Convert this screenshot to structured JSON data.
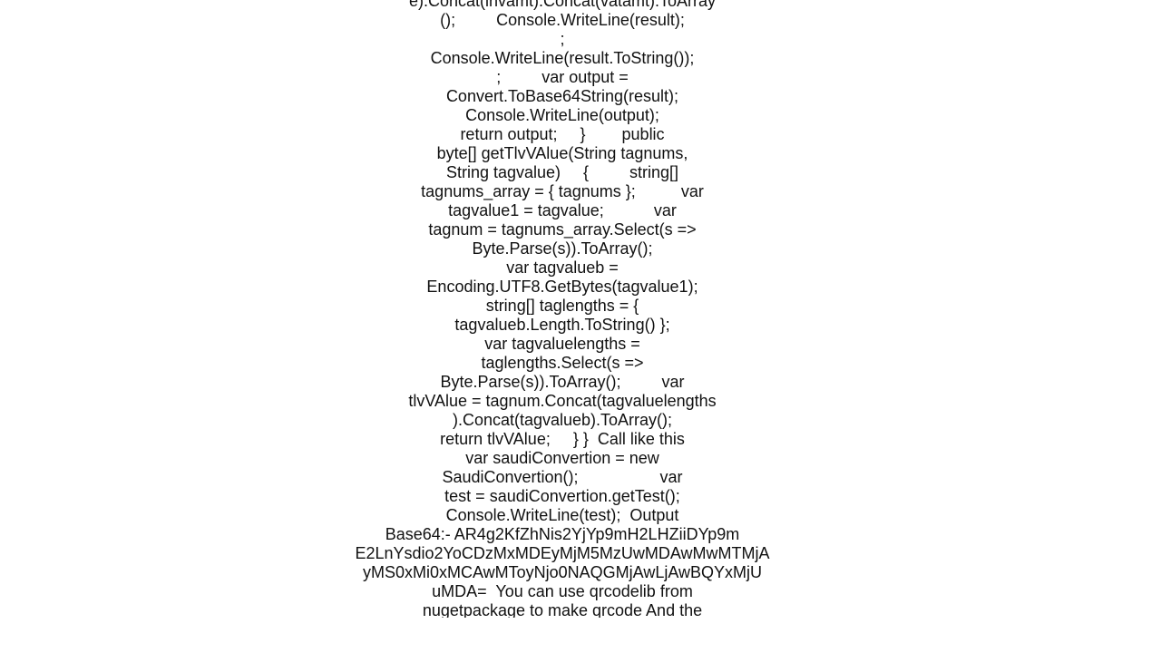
{
  "document": {
    "lines": [
      "e).Concat(invamt).Concat(vatamt).ToArray",
      "();         Console.WriteLine(result);",
      ";",
      "Console.WriteLine(result.ToString());",
      ";         var output =",
      "Convert.ToBase64String(result);",
      "Console.WriteLine(output);",
      "return output;     }        public",
      "byte[] getTlvVAlue(String tagnums,",
      "String tagvalue)     {         string[]",
      "tagnums_array = { tagnums };          var",
      "tagvalue1 = tagvalue;           var",
      "tagnum = tagnums_array.Select(s =>",
      "Byte.Parse(s)).ToArray();",
      "var tagvalueb =",
      "Encoding.UTF8.GetBytes(tagvalue1);",
      "string[] taglengths = {",
      "tagvalueb.Length.ToString() };",
      "var tagvaluelengths =",
      "taglengths.Select(s =>",
      "Byte.Parse(s)).ToArray();         var",
      "tlvVAlue = tagnum.Concat(tagvaluelengths",
      ").Concat(tagvalueb).ToArray();",
      "return tlvVAlue;     } }  Call like this",
      "var saudiConvertion = new",
      "SaudiConvertion();                  var",
      "test = saudiConvertion.getTest();",
      "Console.WriteLine(test);  Output",
      "Base64:- AR4g2KfZhNis2YjYp9mH2LHZiiDYp9m",
      "E2LnYsdio2YoCDzMxMDEyMjM5MzUwMDAwMwMTMjA",
      "yMS0xMi0xMCAwMToyNjo0NAQGMjAwLjAwBQYxMjU",
      "uMDA=  You can use qrcodelib from",
      "nugetpackage to make qrcode And the"
    ]
  }
}
